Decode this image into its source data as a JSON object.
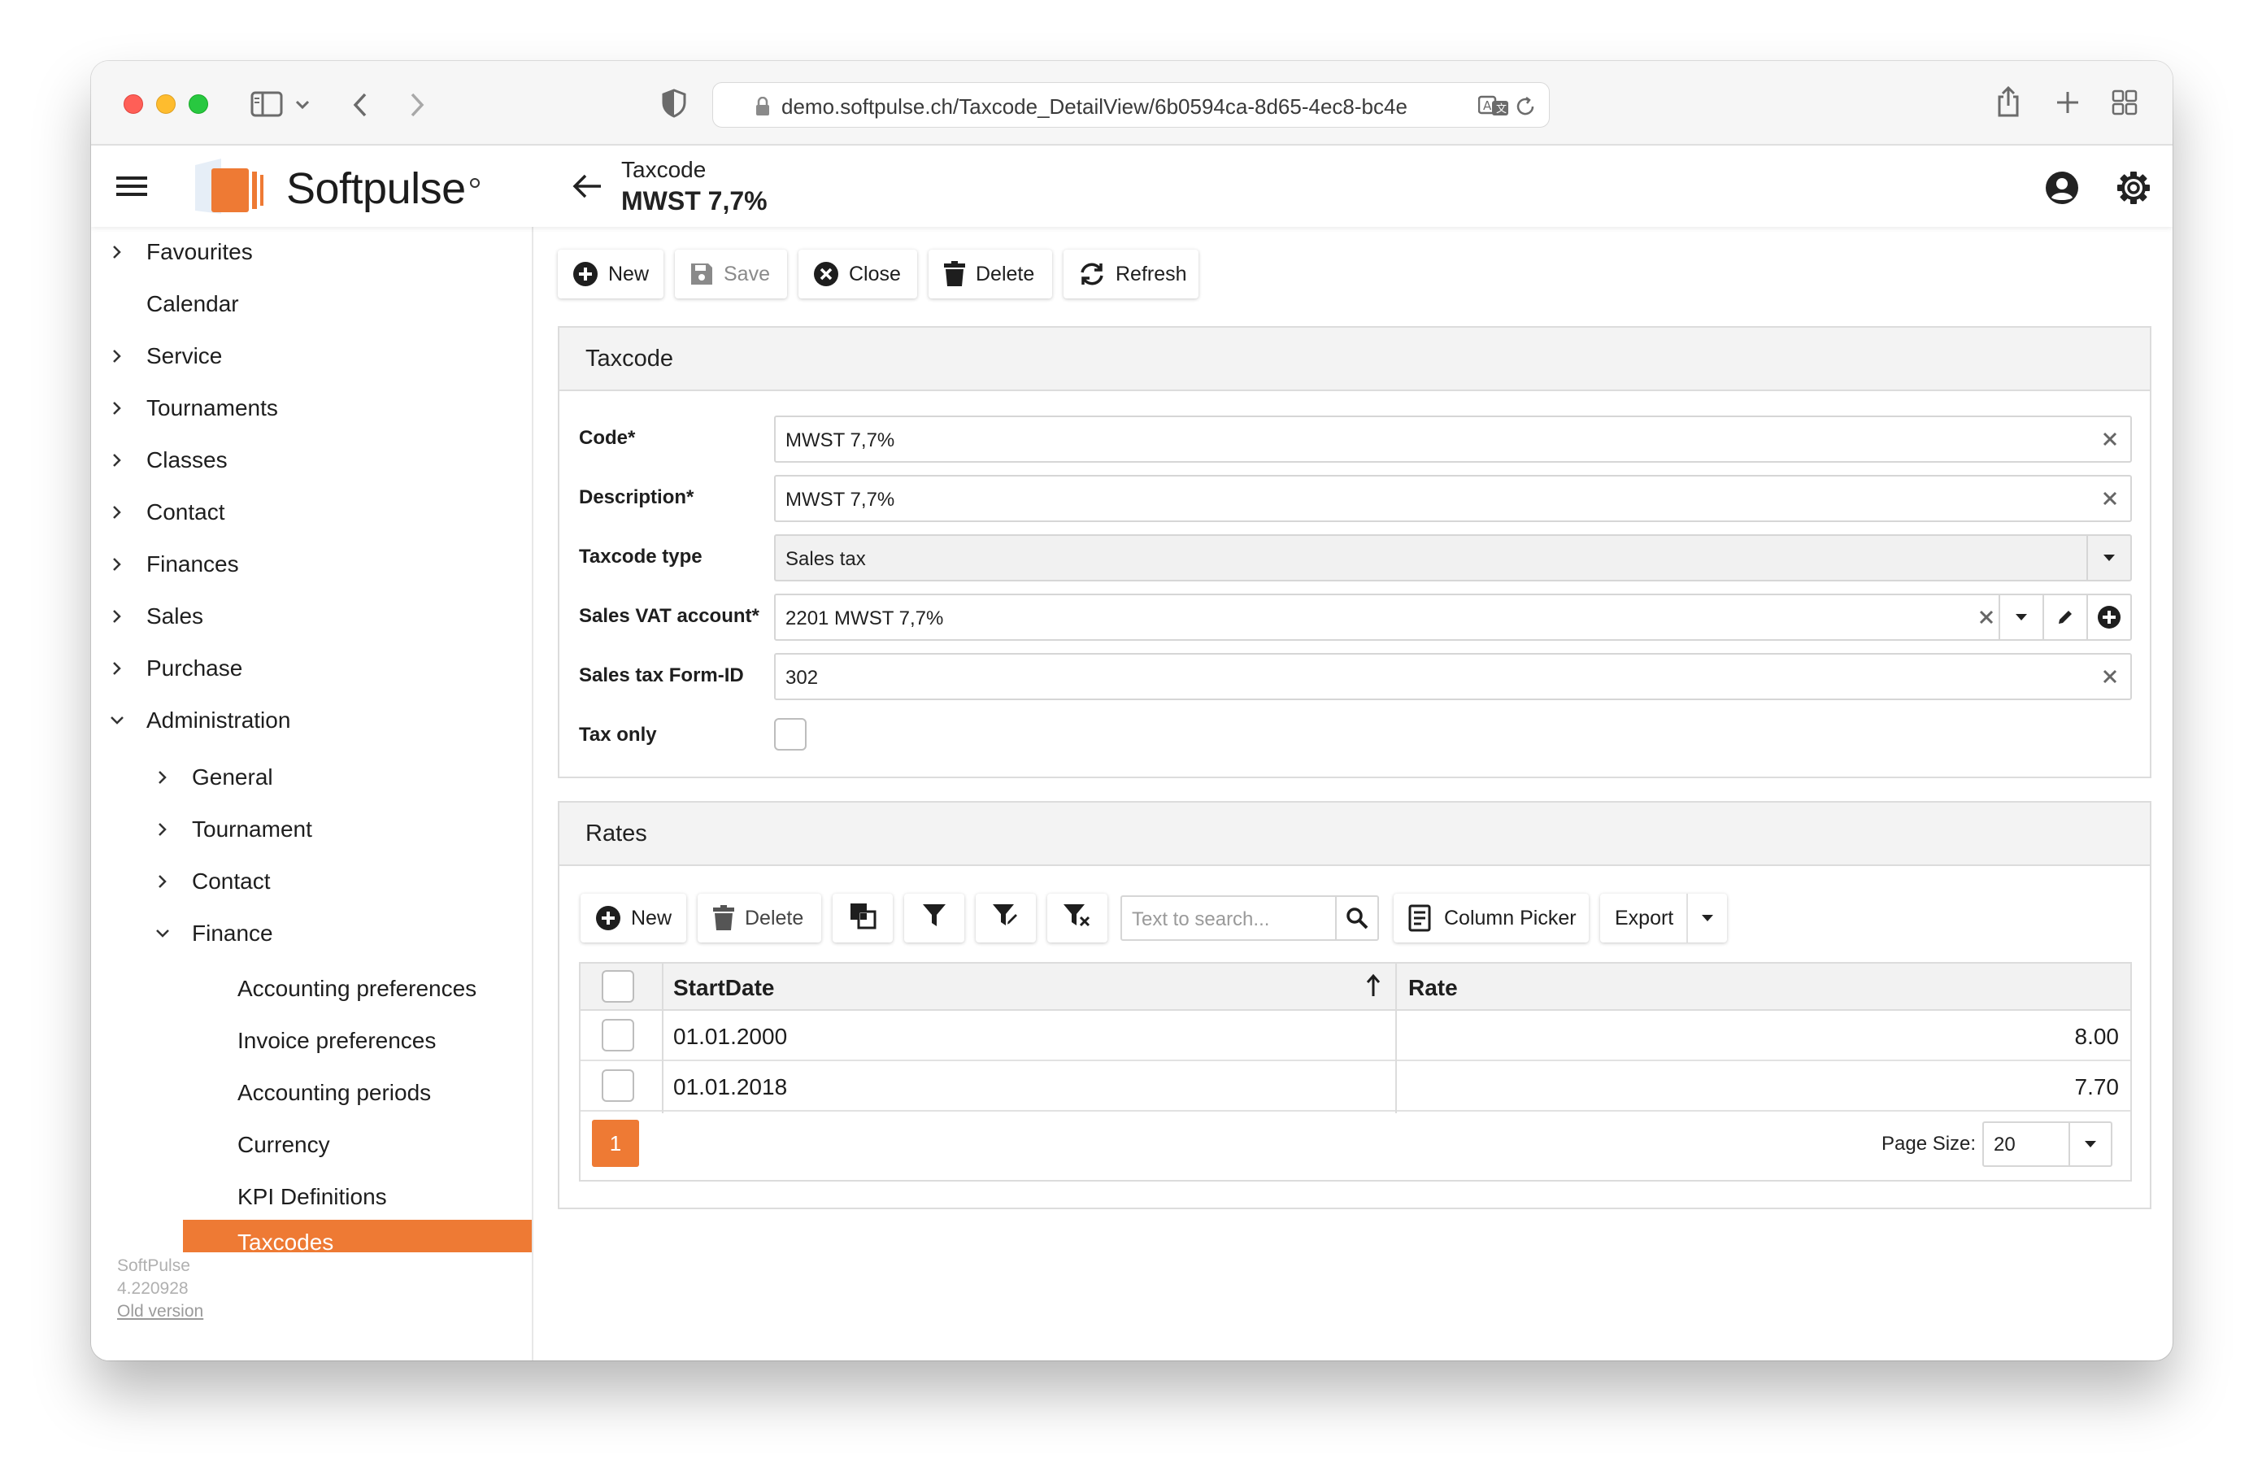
{
  "browser": {
    "url": "demo.softpulse.ch/Taxcode_DetailView/6b0594ca-8d65-4ec8-bc4e"
  },
  "header": {
    "logo_text": "Softpulse",
    "section": "Taxcode",
    "title": "MWST 7,7%"
  },
  "sidebar": {
    "items": [
      {
        "label": "Favourites"
      },
      {
        "label": "Calendar"
      },
      {
        "label": "Service"
      },
      {
        "label": "Tournaments"
      },
      {
        "label": "Classes"
      },
      {
        "label": "Contact"
      },
      {
        "label": "Finances"
      },
      {
        "label": "Sales"
      },
      {
        "label": "Purchase"
      },
      {
        "label": "Administration"
      },
      {
        "label": "General"
      },
      {
        "label": "Tournament"
      },
      {
        "label": "Contact"
      },
      {
        "label": "Finance"
      },
      {
        "label": "Accounting preferences"
      },
      {
        "label": "Invoice preferences"
      },
      {
        "label": "Accounting periods"
      },
      {
        "label": "Currency"
      },
      {
        "label": "KPI Definitions"
      },
      {
        "label": "Taxcodes"
      }
    ],
    "footer": {
      "app_name": "SoftPulse",
      "version": "4.220928",
      "old_version_link": "Old version"
    }
  },
  "toolbar": {
    "new_label": "New",
    "save_label": "Save",
    "close_label": "Close",
    "delete_label": "Delete",
    "refresh_label": "Refresh"
  },
  "taxcode_panel": {
    "title": "Taxcode",
    "fields": {
      "code": {
        "label": "Code*",
        "value": "MWST 7,7%"
      },
      "description": {
        "label": "Description*",
        "value": "MWST 7,7%"
      },
      "taxcode_type": {
        "label": "Taxcode type",
        "value": "Sales tax"
      },
      "sales_vat_account": {
        "label": "Sales VAT account*",
        "value": "2201 MWST 7,7%"
      },
      "sales_tax_form_id": {
        "label": "Sales tax Form-ID",
        "value": "302"
      },
      "tax_only": {
        "label": "Tax only",
        "checked": false
      }
    }
  },
  "rates_panel": {
    "title": "Rates",
    "toolbar": {
      "new_label": "New",
      "delete_label": "Delete",
      "search_placeholder": "Text to search...",
      "column_picker_label": "Column Picker",
      "export_label": "Export"
    },
    "columns": [
      "StartDate",
      "Rate"
    ],
    "rows": [
      {
        "start_date": "01.01.2000",
        "rate": "8.00"
      },
      {
        "start_date": "01.01.2018",
        "rate": "7.70"
      }
    ],
    "pager": {
      "current_page": "1",
      "page_size_label": "Page Size:",
      "page_size": "20"
    }
  },
  "colors": {
    "accent": "#ee7a34",
    "panel_header": "#f3f3f3"
  }
}
